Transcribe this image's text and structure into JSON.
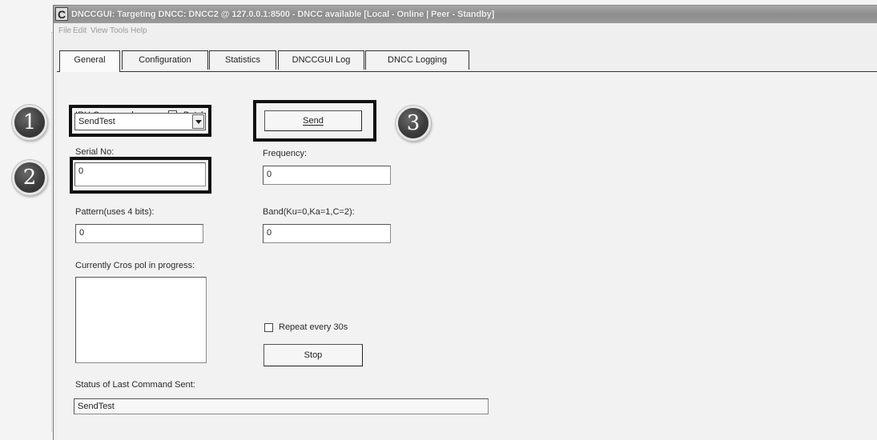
{
  "window": {
    "app_icon_letter": "C",
    "title": "DNCCGUI: Targeting DNCC: DNCC2 @ 127.0.0.1:8500 - DNCC available [Local - Online | Peer - Standby]"
  },
  "menu": [
    "File",
    "Edit",
    "View",
    "Tools",
    "Help"
  ],
  "tabs": [
    {
      "label": "General",
      "active": true
    },
    {
      "label": "Configuration",
      "active": false
    },
    {
      "label": "Statistics",
      "active": false
    },
    {
      "label": "DNCCGUI Log",
      "active": false
    },
    {
      "label": "DNCC Logging",
      "active": false
    }
  ],
  "form": {
    "iru_command_label": "IRU Command:",
    "batch_label": "Batch",
    "iru_command_value": "SendTest",
    "send_label": "Send",
    "serial_label": "Serial No:",
    "serial_value": "0",
    "frequency_label": "Frequency:",
    "frequency_value": "0",
    "pattern_label": "Pattern(uses 4 bits):",
    "pattern_value": "0",
    "band_label": "Band(Ku=0,Ka=1,C=2):",
    "band_value": "0",
    "cross_pol_label": "Currently Cros pol in progress:",
    "repeat_label": "Repeat every 30s",
    "stop_label": "Stop",
    "status_label": "Status of Last Command Sent:",
    "status_value": "SendTest"
  },
  "callouts": [
    "1",
    "2",
    "3"
  ]
}
